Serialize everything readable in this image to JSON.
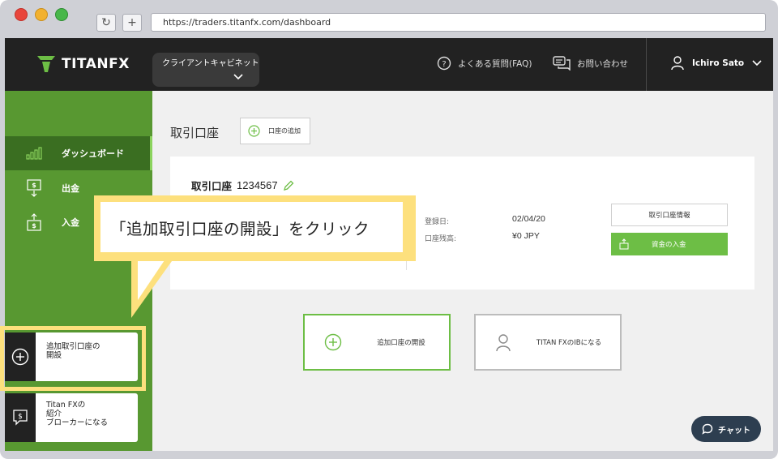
{
  "browser": {
    "url": "https://traders.titanfx.com/dashboard"
  },
  "header": {
    "logo": "TITANFX",
    "cabinet": "クライアントキャビネット",
    "faq": "よくある質問(FAQ)",
    "contact": "お問い合わせ",
    "user_name": "Ichiro Sato"
  },
  "sidebar": {
    "items": [
      {
        "label": "ダッシュボード"
      },
      {
        "label": "出金"
      },
      {
        "label": "入金"
      }
    ],
    "open_account": "追加取引口座の\n開設",
    "ib": "Titan FXの\n紹介\nブローカーになる"
  },
  "main": {
    "title": "取引口座",
    "add_account": "口座の追加",
    "account": {
      "title": "取引口座",
      "number": "1234567",
      "registered_label": "登録日:",
      "registered_value": "02/04/20",
      "balance_label": "口座残高:",
      "balance_value": "¥0 JPY",
      "info_button": "取引口座情報",
      "deposit_button": "資金の入金"
    },
    "add_account_big": "追加口座の開設",
    "become_ib": "TITAN FXのIBになる",
    "chat": "チャット"
  },
  "annotation": {
    "text": "「追加取引口座の開設」をクリック"
  },
  "colors": {
    "brand_green": "#6dbe45",
    "sidebar_green": "#589831",
    "header_dark": "#222222",
    "annotation_yellow": "#fde07d"
  }
}
